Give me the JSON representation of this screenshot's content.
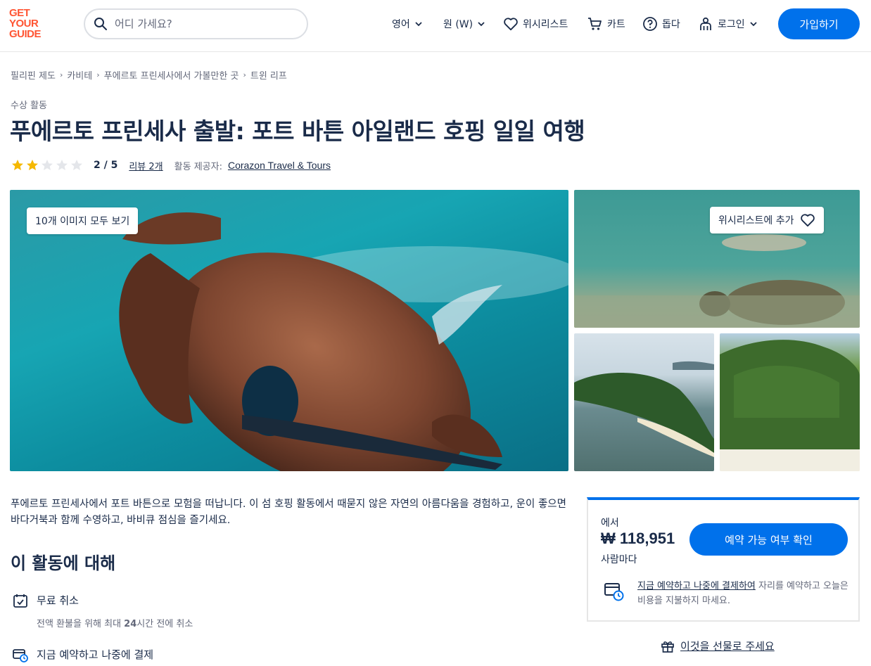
{
  "header": {
    "logo": [
      "GET",
      "YOUR",
      "GUIDE"
    ],
    "search_placeholder": "어디 가세요?",
    "language": "영어",
    "currency": "원 (W)",
    "wishlist": "위시리스트",
    "cart": "카트",
    "help": "돕다",
    "login": "로그인",
    "signup": "가입하기"
  },
  "breadcrumb": [
    "필리핀 제도",
    "카비테",
    "푸에르토 프린세사에서 가볼만한 곳",
    "트윈 리프"
  ],
  "category": "수상 활동",
  "title": "푸에르토 프린세사 출발: 포트 바튼 아일랜드 호핑 일일 여행",
  "rating": {
    "value": 2,
    "max": 5,
    "label": "2 / 5",
    "reviews": "리뷰 2개",
    "provider_label": "활동 제공자:",
    "provider": "Corazon Travel & Tours"
  },
  "gallery": {
    "view_all": "10개 이미지 모두 보기",
    "add_wishlist": "위시리스트에 추가"
  },
  "description": "푸에르토 프린세사에서 포트 바튼으로 모험을 떠납니다. 이 섬 호핑 활동에서 때묻지 않은 자연의 아름다움을 경험하고, 운이 좋으면 바다거북과 함께 수영하고, 바비큐 점심을 즐기세요.",
  "about": {
    "title": "이 활동에 대해",
    "features": [
      {
        "icon": "calendar-check-icon",
        "title": "무료 취소",
        "subtitle_pre": "전액 환불을 위해 최대 ",
        "subtitle_bold": "24",
        "subtitle_post": "시간 전에 취소"
      },
      {
        "icon": "card-clock-icon",
        "title": "지금 예약하고 나중에 결제"
      }
    ]
  },
  "booking": {
    "from": "에서",
    "price": "₩ 118,951",
    "per": "사람마다",
    "check_button": "예약 가능 여부 확인",
    "reserve_link": "지금 예약하고 나중에 결제하여",
    "reserve_text": " 자리를 예약하고 오늘은 비용을 지불하지 마세요."
  },
  "gift": "이것을 선물로 주세요",
  "colors": {
    "accent": "#0071eb",
    "brand": "#ff5533",
    "star": "#f5b800",
    "text": "#1a2b49"
  }
}
